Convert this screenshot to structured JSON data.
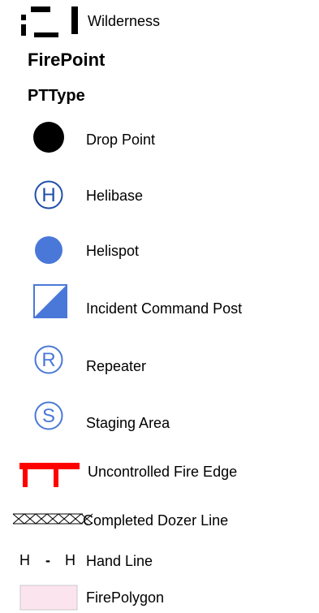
{
  "legend": {
    "wilderness": {
      "label": "Wilderness",
      "icon": "wilderness-boundary-icon"
    },
    "layer_title": "FirePoint",
    "field_title": "PTType",
    "items": [
      {
        "label": "Drop Point",
        "icon": "drop-point-icon",
        "color": "#000000"
      },
      {
        "label": "Helibase",
        "icon": "helibase-icon",
        "symbol": "H",
        "color": "#1f4fa8"
      },
      {
        "label": "Helispot",
        "icon": "helispot-icon",
        "color": "#4a78d8"
      },
      {
        "label": "Incident Command Post",
        "icon": "incident-command-post-icon",
        "color": "#4a78d8"
      },
      {
        "label": "Repeater",
        "icon": "repeater-icon",
        "symbol": "R",
        "color": "#4a78d8"
      },
      {
        "label": "Staging Area",
        "icon": "staging-area-icon",
        "symbol": "S",
        "color": "#4a78d8"
      }
    ],
    "lines": [
      {
        "label": "Uncontrolled Fire Edge",
        "icon": "uncontrolled-fire-edge-icon",
        "color": "#ff0000"
      },
      {
        "label": "Completed Dozer Line",
        "icon": "completed-dozer-line-icon",
        "color": "#000000"
      },
      {
        "label": "Hand Line",
        "icon": "hand-line-icon",
        "symbol_left": "H",
        "symbol_mid": "-",
        "symbol_right": "H",
        "color": "#000000"
      }
    ],
    "polygon": {
      "label": "FirePolygon",
      "icon": "fire-polygon-icon",
      "fill": "#fce4ef",
      "stroke": "#c8c8c8"
    }
  }
}
